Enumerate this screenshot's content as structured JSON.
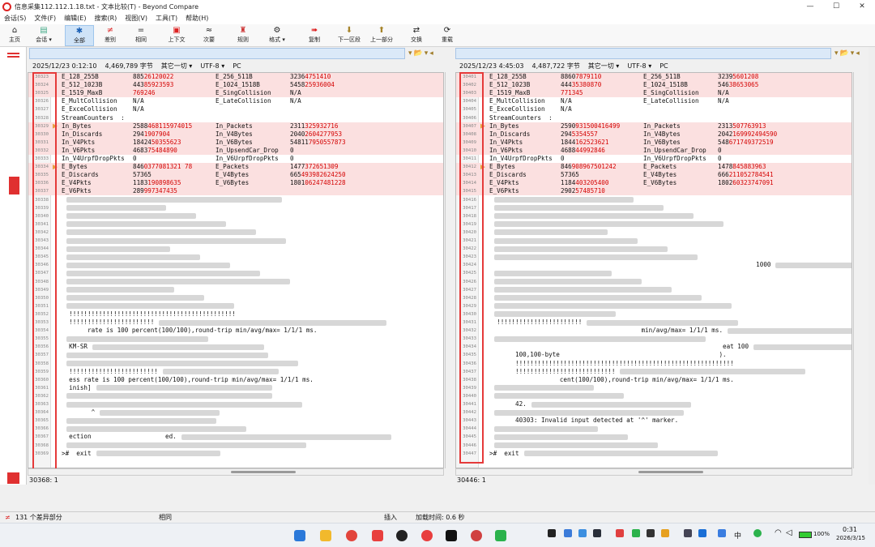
{
  "window": {
    "title": "信息采集112.112.1.18.txt - 文本比较(T) - Beyond Compare"
  },
  "menu": [
    "会话(S)",
    "文件(F)",
    "编辑(E)",
    "搜索(R)",
    "视图(V)",
    "工具(T)",
    "帮助(H)"
  ],
  "toolbar": {
    "home": "主页",
    "session": "会话",
    "all": "全部",
    "diff": "差别",
    "same": "相同",
    "context": "上下文",
    "minor": "次要",
    "rules": "规则",
    "format": "格式",
    "copy": "复制",
    "next_section": "下一区段",
    "prev_section": "上一部分",
    "swap": "交换",
    "reload": "重载"
  },
  "left": {
    "info": {
      "datetime": "2025/12/23 0:12:10",
      "size": "4,469,789 字节",
      "filter": "其它一切",
      "encoding": "UTF-8",
      "lineend": "PC"
    },
    "position": "30368: 1"
  },
  "right": {
    "info": {
      "datetime": "2025/12/23 4:45:03",
      "size": "4,487,722 字节",
      "filter": "其它一切",
      "encoding": "UTF-8",
      "lineend": "PC"
    },
    "position": "30446: 1"
  },
  "left_rows": [
    {
      "n": "30323",
      "d": true,
      "c": [
        [
          "E_128_255B"
        ],
        [
          "885",
          "26120022"
        ],
        [
          "E_256_511B"
        ],
        [
          "3236",
          "4751410"
        ]
      ]
    },
    {
      "n": "30324",
      "d": true,
      "c": [
        [
          "E_512_1023B"
        ],
        [
          "443",
          "85923593"
        ],
        [
          "E_1024_1518B"
        ],
        [
          "5458",
          "25936004"
        ]
      ]
    },
    {
      "n": "30325",
      "d": true,
      "c": [
        [
          "E_1519_MaxB"
        ],
        [
          "",
          "769246"
        ],
        [
          "E_SingCollision"
        ],
        [
          "N/A"
        ]
      ]
    },
    {
      "n": "30326",
      "c": [
        [
          "E_MultCollision"
        ],
        [
          "N/A"
        ],
        [
          "E_LateCollision"
        ],
        [
          "N/A"
        ]
      ]
    },
    {
      "n": "30327",
      "c": [
        [
          "E_ExceCollision"
        ],
        [
          "N/A"
        ]
      ]
    },
    {
      "n": "30328",
      "c": [
        [
          "StreamCounters  :"
        ]
      ]
    },
    {
      "n": "30329",
      "d": true,
      "a": true,
      "c": [
        [
          "In_Bytes"
        ],
        [
          "2588",
          "468115974015"
        ],
        [
          "In_Packets"
        ],
        [
          "2311",
          "325932716"
        ]
      ]
    },
    {
      "n": "30330",
      "d": true,
      "c": [
        [
          "In_Discards"
        ],
        [
          "294",
          "1907904"
        ],
        [
          "In_V4Bytes"
        ],
        [
          "2040",
          "2604277953"
        ]
      ]
    },
    {
      "n": "30331",
      "d": true,
      "c": [
        [
          "In_V4Pkts"
        ],
        [
          "18424",
          "50355623"
        ],
        [
          "In_V6Bytes"
        ],
        [
          "54811",
          "7950557873"
        ]
      ]
    },
    {
      "n": "30332",
      "d": true,
      "c": [
        [
          "In_V6Pkts"
        ],
        [
          "4683",
          "75484890"
        ],
        [
          "In_UpsendCar_Drop"
        ],
        [
          "0"
        ]
      ]
    },
    {
      "n": "30333",
      "c": [
        [
          "In_V4UrpfDropPkts"
        ],
        [
          "0"
        ],
        [
          "In_V6UrpfDropPkts"
        ],
        [
          "0"
        ]
      ]
    },
    {
      "n": "30334",
      "d": true,
      "a": true,
      "c": [
        [
          "E_Bytes"
        ],
        [
          "846",
          "0377081321 78"
        ],
        [
          "E_Packets"
        ],
        [
          "1477",
          "372651309"
        ]
      ]
    },
    {
      "n": "30335",
      "d": true,
      "c": [
        [
          "E_Discards"
        ],
        [
          "57365"
        ],
        [
          "E_V4Bytes"
        ],
        [
          "665",
          "493982624250"
        ]
      ]
    },
    {
      "n": "30336",
      "d": true,
      "c": [
        [
          "E_V4Pkts"
        ],
        [
          "1183",
          "190898635"
        ],
        [
          "E_V6Bytes"
        ],
        [
          "1801",
          "06247481228"
        ]
      ]
    },
    {
      "n": "30337",
      "d": true,
      "c": [
        [
          "E_V6Pkts"
        ],
        [
          "289",
          "997347435"
        ]
      ]
    },
    {
      "n": "30338"
    },
    {
      "n": "30339"
    },
    {
      "n": "30340"
    },
    {
      "n": "30341"
    },
    {
      "n": "30342"
    },
    {
      "n": "30343"
    },
    {
      "n": "30344"
    },
    {
      "n": "30345"
    },
    {
      "n": "30346"
    },
    {
      "n": "30347"
    },
    {
      "n": "30348"
    },
    {
      "n": "30349"
    },
    {
      "n": "30350"
    },
    {
      "n": "30351"
    },
    {
      "n": "30352",
      "t": "  !!!!!!!!!!!!!!!!!!!!!!!!!!!!!!!!!!!!!!!!!!!!!"
    },
    {
      "n": "30353",
      "t": "  !!!!!!!!!!!!!!!!!!!!!!!"
    },
    {
      "n": "30354",
      "t": "       rate is 100 percent(100/100),round-trip min/avg/max= 1/1/1 ms."
    },
    {
      "n": "30355"
    },
    {
      "n": "30356",
      "t": "  KM-SR"
    },
    {
      "n": "30357"
    },
    {
      "n": "30358"
    },
    {
      "n": "30359",
      "t": "  !!!!!!!!!!!!!!!!!!!!!!!!"
    },
    {
      "n": "30360",
      "t": "  ess rate is 100 percent(100/100),round-trip min/avg/max= 1/1/1 ms."
    },
    {
      "n": "30361",
      "t": "  inish]"
    },
    {
      "n": "30362"
    },
    {
      "n": "30363"
    },
    {
      "n": "30364",
      "t": "        ^"
    },
    {
      "n": "30365"
    },
    {
      "n": "30366"
    },
    {
      "n": "30367",
      "t": "  ection                    ed."
    },
    {
      "n": "30368"
    },
    {
      "n": "30369",
      "t": ">#  exit"
    }
  ],
  "right_rows": [
    {
      "n": "30401",
      "d": true,
      "c": [
        [
          "E_128_255B"
        ],
        [
          "8860",
          "7879110"
        ],
        [
          "E_256_511B"
        ],
        [
          "3239",
          "5601208"
        ]
      ]
    },
    {
      "n": "30402",
      "d": true,
      "c": [
        [
          "E_512_1023B"
        ],
        [
          "444",
          "35380870"
        ],
        [
          "E_1024_1518B"
        ],
        [
          "546",
          "38653065"
        ]
      ]
    },
    {
      "n": "30403",
      "d": true,
      "c": [
        [
          "E_1519_MaxB"
        ],
        [
          "",
          "771345"
        ],
        [
          "E_SingCollision"
        ],
        [
          "N/A"
        ]
      ]
    },
    {
      "n": "30404",
      "c": [
        [
          "E_MultCollision"
        ],
        [
          "N/A"
        ],
        [
          "E_LateCollision"
        ],
        [
          "N/A"
        ]
      ]
    },
    {
      "n": "30405",
      "c": [
        [
          "E_ExceCollision"
        ],
        [
          "N/A"
        ]
      ]
    },
    {
      "n": "30406",
      "c": [
        [
          "StreamCounters  :"
        ]
      ]
    },
    {
      "n": "30407",
      "d": true,
      "a": true,
      "c": [
        [
          "In_Bytes"
        ],
        [
          "2590",
          "931500416499"
        ],
        [
          "In_Packets"
        ],
        [
          "2313",
          "507763913"
        ]
      ]
    },
    {
      "n": "30408",
      "d": true,
      "c": [
        [
          "In_Discards"
        ],
        [
          "294",
          "5354557"
        ],
        [
          "In_V4Bytes"
        ],
        [
          "2042",
          "169992494590"
        ]
      ]
    },
    {
      "n": "30409",
      "d": true,
      "c": [
        [
          "In_V4Pkts"
        ],
        [
          "1844",
          "162523621"
        ],
        [
          "In_V6Bytes"
        ],
        [
          "548",
          "671749372519"
        ]
      ]
    },
    {
      "n": "30410",
      "d": true,
      "c": [
        [
          "In_V6Pkts"
        ],
        [
          "4688",
          "44992846"
        ],
        [
          "In_UpsendCar_Drop"
        ],
        [
          "0"
        ]
      ]
    },
    {
      "n": "30411",
      "c": [
        [
          "In_V4UrpfDropPkts"
        ],
        [
          "0"
        ],
        [
          "In_V6UrpfDropPkts"
        ],
        [
          "0"
        ]
      ]
    },
    {
      "n": "30412",
      "d": true,
      "a": true,
      "c": [
        [
          "E_Bytes"
        ],
        [
          "846",
          "908967501242"
        ],
        [
          "E_Packets"
        ],
        [
          "1478",
          "845883963"
        ]
      ]
    },
    {
      "n": "30413",
      "d": true,
      "c": [
        [
          "E_Discards"
        ],
        [
          "57365"
        ],
        [
          "E_V4Bytes"
        ],
        [
          "666",
          "211052784541"
        ]
      ]
    },
    {
      "n": "30414",
      "d": true,
      "c": [
        [
          "E_V4Pkts"
        ],
        [
          "1184",
          "403205400"
        ],
        [
          "E_V6Bytes"
        ],
        [
          "1802",
          "60323747091"
        ]
      ]
    },
    {
      "n": "30415",
      "d": true,
      "c": [
        [
          "E_V6Pkts"
        ],
        [
          "2902",
          "57485710"
        ]
      ]
    },
    {
      "n": "30416"
    },
    {
      "n": "30417"
    },
    {
      "n": "30418"
    },
    {
      "n": "30419"
    },
    {
      "n": "30420"
    },
    {
      "n": "30421"
    },
    {
      "n": "30422"
    },
    {
      "n": "30423"
    },
    {
      "n": "30424",
      "t": "                                                                        1000"
    },
    {
      "n": "30425"
    },
    {
      "n": "30426"
    },
    {
      "n": "30427"
    },
    {
      "n": "30428"
    },
    {
      "n": "30429"
    },
    {
      "n": "30430"
    },
    {
      "n": "30431",
      "t": "  !!!!!!!!!!!!!!!!!!!!!!!"
    },
    {
      "n": "30432",
      "t": "                                         min/avg/max= 1/1/1 ms."
    },
    {
      "n": "30433"
    },
    {
      "n": "30434",
      "t": "                                                               eat 100"
    },
    {
      "n": "30435",
      "t": "       100,100-byte                                           )."
    },
    {
      "n": "30436",
      "t": "       !!!!!!!!!!!!!!!!!!!!!!!!!!!!!!!!!!!!!!!!!!!!!!!!!!!!!!!!!!!"
    },
    {
      "n": "30437",
      "t": "       !!!!!!!!!!!!!!!!!!!!!!!!!!!"
    },
    {
      "n": "30438",
      "t": "                   cent(100/100),round-trip min/avg/max= 1/1/1 ms."
    },
    {
      "n": "30439"
    },
    {
      "n": "30440"
    },
    {
      "n": "30441",
      "t": "       42."
    },
    {
      "n": "30442"
    },
    {
      "n": "30443",
      "t": "       40303: Invalid input detected at '^' marker."
    },
    {
      "n": "30444"
    },
    {
      "n": "30445"
    },
    {
      "n": "30446"
    },
    {
      "n": "30447",
      "t": ">#  exit"
    }
  ],
  "status": {
    "diff_count": "131 个差异部分",
    "same": "相同",
    "mode": "插入",
    "load_time": "加载时间:  0.6 秒"
  },
  "taskbar": {
    "ime": "中",
    "battery": "100%",
    "time": "0:31",
    "date": "2026/3/15"
  }
}
